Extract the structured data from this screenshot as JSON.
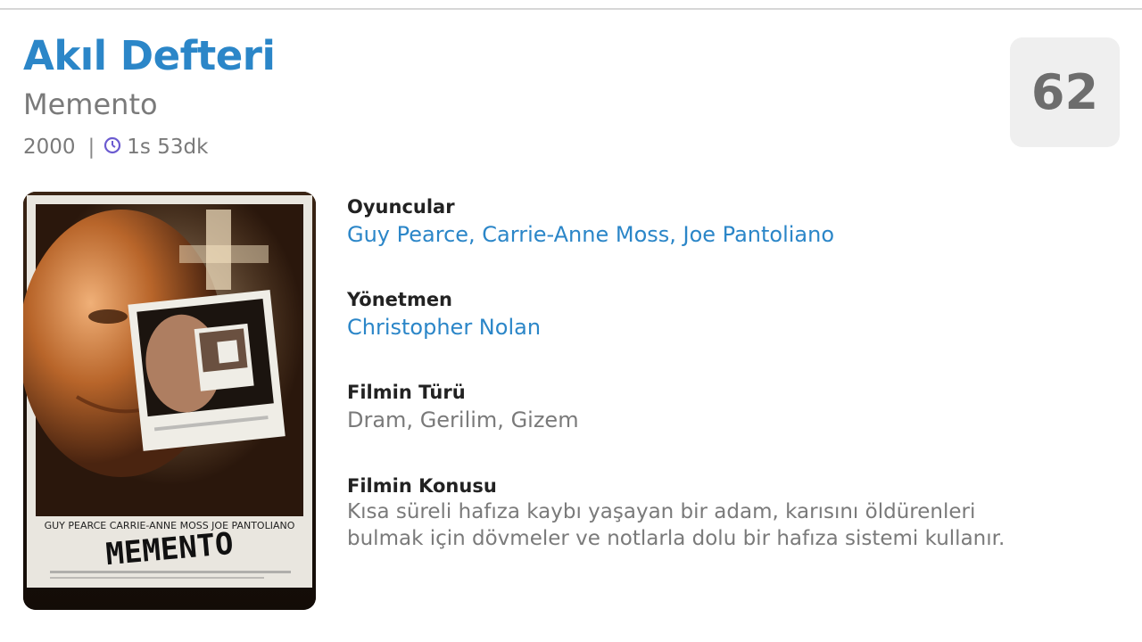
{
  "movie": {
    "title": "Akıl Defteri",
    "original_title": "Memento",
    "year": "2000",
    "separator": "|",
    "duration": "1s 53dk",
    "score": "62"
  },
  "poster": {
    "cast_line": "GUY PEARCE   CARRIE-ANNE MOSS   JOE PANTOLIANO",
    "title_text": "MEMENTO"
  },
  "details": {
    "cast_label": "Oyuncular",
    "cast_value": "Guy Pearce, Carrie-Anne Moss, Joe Pantoliano",
    "director_label": "Yönetmen",
    "director_value": "Christopher Nolan",
    "genre_label": "Filmin Türü",
    "genre_value": "Dram, Gerilim, Gizem",
    "plot_label": "Filmin Konusu",
    "plot_line1": "Kısa süreli hafıza kaybı yaşayan bir adam, karısını öldürenleri",
    "plot_line2": "bulmak için dövmeler ve notlarla dolu bir hafıza sistemi kullanır."
  },
  "colors": {
    "accent": "#2b86c8",
    "muted": "#7a7a7a",
    "clock": "#6b5bd0"
  },
  "icons": {
    "duration": "clock-icon"
  }
}
